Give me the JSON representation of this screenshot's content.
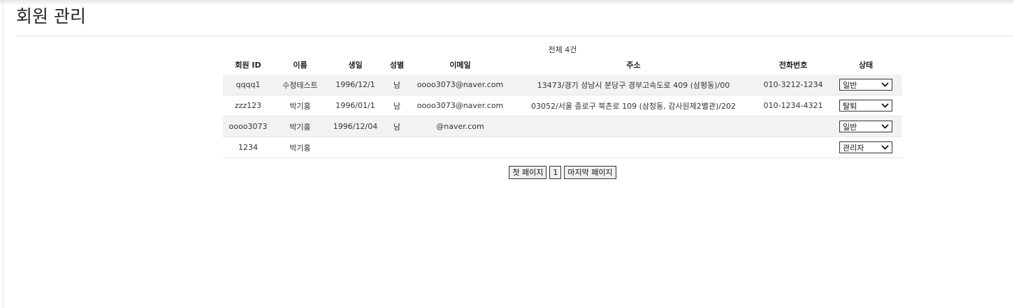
{
  "page": {
    "title": "회원 관리"
  },
  "summary": {
    "total": "전체 4건"
  },
  "table": {
    "headers": {
      "id": "회원 ID",
      "name": "이름",
      "birth": "생일",
      "gender": "성별",
      "email": "이메일",
      "address": "주소",
      "phone": "전화번호",
      "status": "상태"
    },
    "rows": [
      {
        "id": "qqqq1",
        "name": "수정테스트",
        "birth": "1996/12/1",
        "gender": "남",
        "email": "oooo3073@naver.com",
        "address": "13473/경기 성남시 분당구 경부고속도로 409 (삼평동)/00",
        "phone": "010-3212-1234",
        "status": "일반"
      },
      {
        "id": "zzz123",
        "name": "박기홍",
        "birth": "1996/01/1",
        "gender": "남",
        "email": "oooo3073@naver.com",
        "address": "03052/서울 종로구 북촌로 109 (삼청동, 감사원제2별관)/202",
        "phone": "010-1234-4321",
        "status": "탈퇴"
      },
      {
        "id": "oooo3073",
        "name": "박기홍",
        "birth": "1996/12/04",
        "gender": "남",
        "email": "@naver.com",
        "address": "",
        "phone": "",
        "status": "일반"
      },
      {
        "id": "1234",
        "name": "박기홍",
        "birth": "",
        "gender": "",
        "email": "",
        "address": "",
        "phone": "",
        "status": "관리자"
      }
    ]
  },
  "pagination": {
    "first": "첫 페이지",
    "current": "1",
    "last": "마지막 페이지"
  },
  "icons": {
    "dropdown": "chevron-down-icon"
  }
}
